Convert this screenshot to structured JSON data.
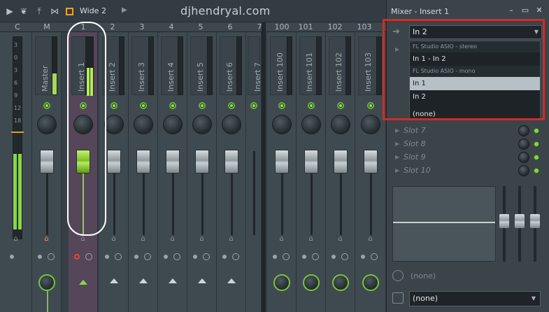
{
  "toolbar": {
    "view_label": "Wide 2",
    "icons": [
      "play-icon",
      "bird-icon",
      "upload-icon",
      "bowtie-icon",
      "view-icon",
      "arrow-right-icon"
    ]
  },
  "watermark": "djhendryal.com",
  "columns": [
    "C",
    "M",
    "1",
    "2",
    "3",
    "4",
    "5",
    "6",
    "7",
    "100",
    "101",
    "102",
    "103"
  ],
  "strips": [
    {
      "name": "Master"
    },
    {
      "name": "Insert 1"
    },
    {
      "name": "Insert 2"
    },
    {
      "name": "Insert 3"
    },
    {
      "name": "Insert 4"
    },
    {
      "name": "Insert 5"
    },
    {
      "name": "Insert 6"
    },
    {
      "name": "Insert 7"
    },
    {
      "name": "Insert 100"
    },
    {
      "name": "Insert 101"
    },
    {
      "name": "Insert 102"
    },
    {
      "name": "Insert 103"
    }
  ],
  "meter_scale": [
    "3",
    "0",
    "3",
    "6",
    "9",
    "12",
    "18"
  ],
  "panel": {
    "title": "Mixer - Insert 1",
    "input_value": "In 2",
    "dropdown": {
      "header_stereo": "FL Studio ASIO - stereo",
      "stereo_items": [
        "In 1 - In 2"
      ],
      "header_mono": "FL Studio ASIO - mono",
      "mono_items": [
        "In 1",
        "In 2"
      ],
      "none_item": "(none)",
      "highlighted": "In 1"
    },
    "slots": [
      "Slot 7",
      "Slot 8",
      "Slot 9",
      "Slot 10"
    ],
    "eq_none": "(none)",
    "output_value": "(none)"
  },
  "colors": {
    "accent_green": "#8bd44a",
    "selection_red": "#d12b2b",
    "view_orange": "#e8a23a"
  }
}
